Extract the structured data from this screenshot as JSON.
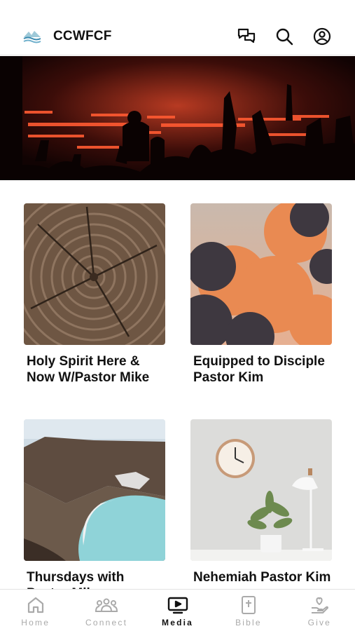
{
  "header": {
    "title": "CCWFCF",
    "icons": [
      "logo-icon",
      "chat-icon",
      "search-icon",
      "profile-icon"
    ]
  },
  "hero": {
    "image": "concert-crowd-hands-raised"
  },
  "media": {
    "cards": [
      {
        "title": "Holy Spirit Here & Now W/Pastor Mike",
        "image": "tree-rings"
      },
      {
        "title": "Equipped to Disciple Pastor Kim",
        "image": "sunset-clouds"
      },
      {
        "title": "Thursdays with Pastor Mike",
        "image": "volcanic-lake"
      },
      {
        "title": "Nehemiah Pastor Kim",
        "image": "clock-and-plant"
      }
    ]
  },
  "tabs": [
    {
      "label": "Home",
      "icon": "home-icon",
      "active": false
    },
    {
      "label": "Connect",
      "icon": "people-icon",
      "active": false
    },
    {
      "label": "Media",
      "icon": "tv-play-icon",
      "active": true
    },
    {
      "label": "Bible",
      "icon": "bible-icon",
      "active": false
    },
    {
      "label": "Give",
      "icon": "heart-hand-icon",
      "active": false
    }
  ],
  "colors": {
    "active": "#111111",
    "inactive": "#aaaaaa",
    "divider": "#e3e3e3"
  }
}
